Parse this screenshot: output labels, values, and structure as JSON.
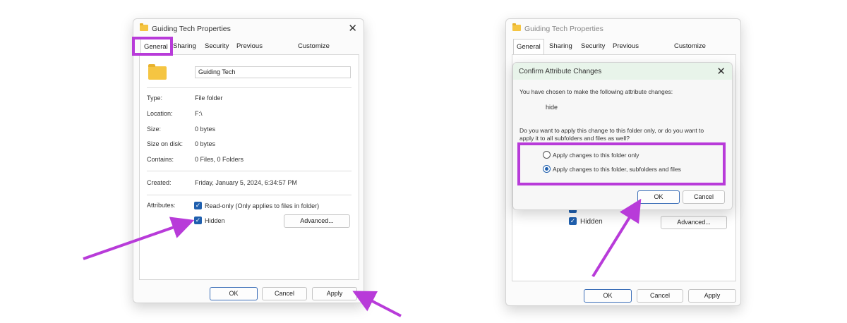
{
  "left_window": {
    "title": "Guiding Tech Properties",
    "tabs": [
      "General",
      "Sharing",
      "Security",
      "Previous Versions",
      "Customize"
    ],
    "folder_name_value": "Guiding Tech",
    "fields": [
      {
        "label": "Type:",
        "value": "File folder"
      },
      {
        "label": "Location:",
        "value": "F:\\"
      },
      {
        "label": "Size:",
        "value": "0 bytes"
      },
      {
        "label": "Size on disk:",
        "value": "0 bytes"
      },
      {
        "label": "Contains:",
        "value": "0 Files, 0 Folders"
      },
      {
        "label": "Created:",
        "value": "Friday, January 5, 2024, 6:34:57 PM"
      }
    ],
    "attributes_label": "Attributes:",
    "readonly_label": "Read-only (Only applies to files in folder)",
    "hidden_label": "Hidden",
    "advanced_button": "Advanced...",
    "ok_button": "OK",
    "cancel_button": "Cancel",
    "apply_button": "Apply"
  },
  "right_window": {
    "title": "Guiding Tech Properties",
    "tabs": [
      "General",
      "Sharing",
      "Security",
      "Previous Versions",
      "Customize"
    ],
    "hidden_label": "Hidden",
    "advanced_button": "Advanced...",
    "ok_button": "OK",
    "cancel_button": "Cancel",
    "apply_button": "Apply"
  },
  "confirm_dialog": {
    "title": "Confirm Attribute Changes",
    "intro": "You have chosen to make the following attribute changes:",
    "change": "hide",
    "question_line1": "Do you want to apply this change to this folder only, or do you want to",
    "question_line2": "apply it to all subfolders and files as well?",
    "option1": "Apply changes to this folder only",
    "option2": "Apply changes to this folder, subfolders and files",
    "selected_option": 2,
    "ok_button": "OK",
    "cancel_button": "Cancel"
  },
  "colors": {
    "highlight": "#b83bd9",
    "arrow": "#b83bd9",
    "checkbox": "#1f5fae",
    "dialog_title_bg": "#e8f4ea"
  }
}
